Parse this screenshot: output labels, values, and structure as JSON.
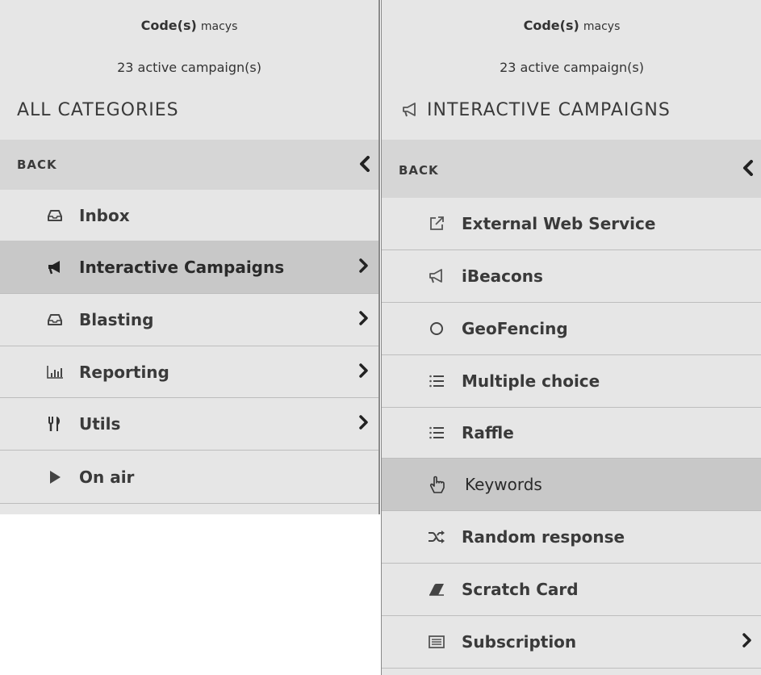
{
  "left": {
    "code_key": "Code(s)",
    "code_value": "macys",
    "campaigns": "23 active campaign(s)",
    "title": "ALL CATEGORIES",
    "back_label": "BACK",
    "items": [
      {
        "label": "Inbox",
        "icon": "inbox-icon",
        "has_arrow": false,
        "selected": false
      },
      {
        "label": "Interactive Campaigns",
        "icon": "megaphone-icon",
        "has_arrow": true,
        "selected": true
      },
      {
        "label": "Blasting",
        "icon": "inbox-icon",
        "has_arrow": true,
        "selected": false
      },
      {
        "label": "Reporting",
        "icon": "bar-chart-icon",
        "has_arrow": true,
        "selected": false
      },
      {
        "label": "Utils",
        "icon": "fork-knife-icon",
        "has_arrow": true,
        "selected": false
      },
      {
        "label": "On air",
        "icon": "play-icon",
        "has_arrow": false,
        "selected": false
      }
    ]
  },
  "right": {
    "code_key": "Code(s)",
    "code_value": "macys",
    "campaigns": "23 active campaign(s)",
    "title": "INTERACTIVE CAMPAIGNS",
    "title_icon": "megaphone-icon",
    "back_label": "BACK",
    "items": [
      {
        "label": "External Web Service",
        "icon": "external-link-icon",
        "has_arrow": false,
        "selected": false
      },
      {
        "label": "iBeacons",
        "icon": "megaphone-icon",
        "has_arrow": false,
        "selected": false
      },
      {
        "label": "GeoFencing",
        "icon": "circle-icon",
        "has_arrow": false,
        "selected": false
      },
      {
        "label": "Multiple choice",
        "icon": "list-icon",
        "has_arrow": false,
        "selected": false
      },
      {
        "label": "Raffle",
        "icon": "list-icon",
        "has_arrow": false,
        "selected": false
      },
      {
        "label": "Keywords",
        "icon": "hand-pointer-icon",
        "has_arrow": false,
        "selected": true
      },
      {
        "label": "Random response",
        "icon": "shuffle-icon",
        "has_arrow": false,
        "selected": false
      },
      {
        "label": "Scratch Card",
        "icon": "eraser-icon",
        "has_arrow": false,
        "selected": false
      },
      {
        "label": "Subscription",
        "icon": "newspaper-icon",
        "has_arrow": true,
        "selected": false
      }
    ]
  }
}
